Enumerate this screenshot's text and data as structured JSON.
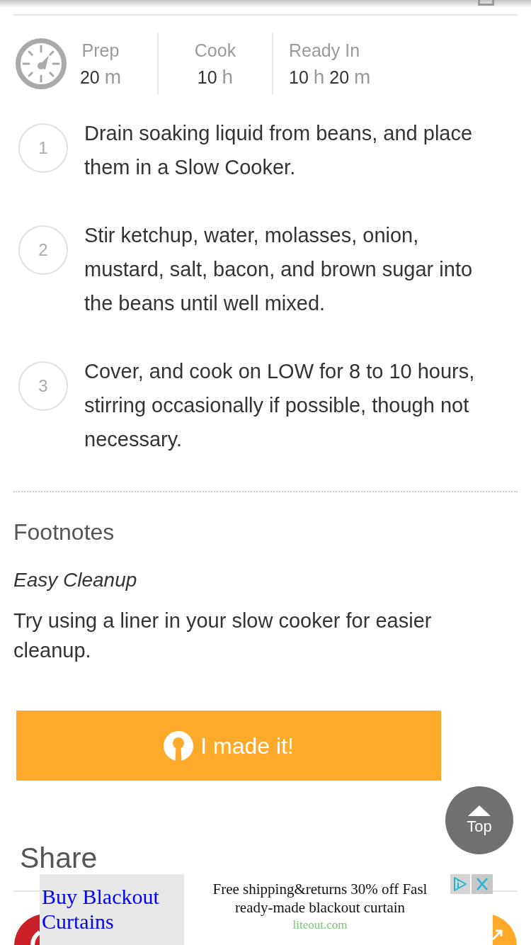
{
  "times": [
    {
      "label": "Prep",
      "parts": [
        {
          "number": "20",
          "unit": "m"
        }
      ]
    },
    {
      "label": "Cook",
      "parts": [
        {
          "number": "10",
          "unit": "h"
        }
      ]
    },
    {
      "label": "Ready In",
      "parts": [
        {
          "number": "10",
          "unit": "h"
        },
        {
          "number": "20",
          "unit": "m"
        }
      ]
    }
  ],
  "steps": [
    {
      "number": "1",
      "text": "Drain soaking liquid from beans, and place them in a Slow Cooker."
    },
    {
      "number": "2",
      "text": "Stir ketchup, water, molasses, onion, mustard, salt, bacon, and brown sugar into the beans until well mixed."
    },
    {
      "number": "3",
      "text": "Cover, and cook on LOW for 8 to 10 hours, stirring occasionally if possible, though not necessary."
    }
  ],
  "footnotes": {
    "heading": "Footnotes",
    "title": "Easy Cleanup",
    "text": "Try using a liner in your slow cooker for easier cleanup."
  },
  "made_it_button": {
    "label": "I made it!"
  },
  "top_button": {
    "label": "Top"
  },
  "share": {
    "heading": "Share"
  },
  "ad": {
    "headline": "Buy Blackout Curtains",
    "lines": [
      "Free shipping&returns 30% off Fasl",
      "ready-made blackout curtain"
    ],
    "domain": "liteout.com"
  }
}
